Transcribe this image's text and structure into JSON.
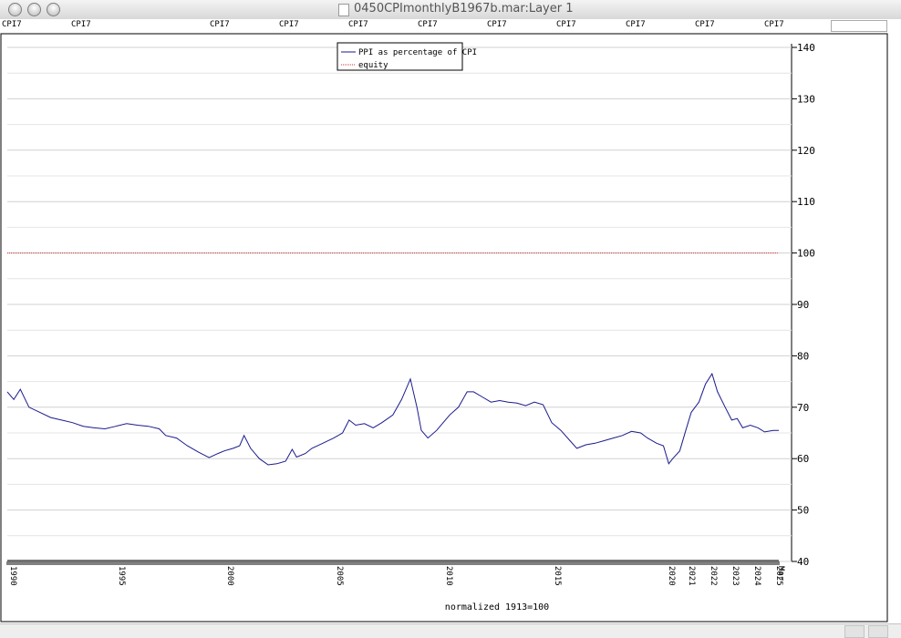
{
  "window": {
    "title": "0450CPImonthlyB1967b.mar:Layer 1"
  },
  "tag_label": "CPI7",
  "tag_count": 12,
  "chart_data": {
    "type": "line",
    "xlabel": "normalized 1913=100",
    "ylim": [
      40,
      140
    ],
    "yticks": [
      40,
      50,
      60,
      70,
      80,
      90,
      100,
      110,
      120,
      130,
      140
    ],
    "xticks": [
      "1990",
      "1995",
      "2000",
      "2005",
      "2010",
      "2015",
      "2020",
      "2021",
      "2022",
      "2023",
      "2024",
      "2025",
      "Mar"
    ],
    "grid": true,
    "legend_position": "top-center",
    "series": [
      {
        "name": "PPI as percentage of CPI",
        "color": "#1a1a8c",
        "points": [
          [
            1990.0,
            73.0
          ],
          [
            1990.3,
            71.5
          ],
          [
            1990.6,
            73.5
          ],
          [
            1991.0,
            70.0
          ],
          [
            1991.5,
            69.0
          ],
          [
            1992.0,
            68.0
          ],
          [
            1992.5,
            67.5
          ],
          [
            1993.0,
            67.0
          ],
          [
            1993.5,
            66.3
          ],
          [
            1994.0,
            66.0
          ],
          [
            1994.5,
            65.8
          ],
          [
            1995.0,
            66.3
          ],
          [
            1995.5,
            66.8
          ],
          [
            1996.0,
            66.5
          ],
          [
            1996.5,
            66.3
          ],
          [
            1997.0,
            65.8
          ],
          [
            1997.3,
            64.5
          ],
          [
            1997.8,
            64.0
          ],
          [
            1998.3,
            62.5
          ],
          [
            1998.8,
            61.3
          ],
          [
            1999.3,
            60.2
          ],
          [
            1999.7,
            61.0
          ],
          [
            2000.0,
            61.5
          ],
          [
            2000.4,
            62.0
          ],
          [
            2000.7,
            62.5
          ],
          [
            2000.9,
            64.5
          ],
          [
            2001.2,
            62.0
          ],
          [
            2001.6,
            60.0
          ],
          [
            2002.0,
            58.8
          ],
          [
            2002.4,
            59.0
          ],
          [
            2002.8,
            59.5
          ],
          [
            2003.1,
            61.8
          ],
          [
            2003.3,
            60.3
          ],
          [
            2003.7,
            61.0
          ],
          [
            2004.0,
            62.0
          ],
          [
            2004.5,
            63.0
          ],
          [
            2005.0,
            64.0
          ],
          [
            2005.4,
            65.0
          ],
          [
            2005.7,
            67.5
          ],
          [
            2006.0,
            66.5
          ],
          [
            2006.4,
            66.8
          ],
          [
            2006.8,
            66.0
          ],
          [
            2007.2,
            67.0
          ],
          [
            2007.7,
            68.5
          ],
          [
            2008.1,
            71.5
          ],
          [
            2008.5,
            75.5
          ],
          [
            2008.8,
            70.0
          ],
          [
            2009.0,
            65.5
          ],
          [
            2009.3,
            64.0
          ],
          [
            2009.7,
            65.5
          ],
          [
            2010.0,
            67.0
          ],
          [
            2010.3,
            68.5
          ],
          [
            2010.7,
            70.0
          ],
          [
            2011.1,
            73.0
          ],
          [
            2011.4,
            73.0
          ],
          [
            2011.8,
            72.0
          ],
          [
            2012.2,
            71.0
          ],
          [
            2012.6,
            71.3
          ],
          [
            2013.0,
            71.0
          ],
          [
            2013.4,
            70.8
          ],
          [
            2013.8,
            70.3
          ],
          [
            2014.2,
            71.0
          ],
          [
            2014.6,
            70.5
          ],
          [
            2015.0,
            67.0
          ],
          [
            2015.4,
            65.5
          ],
          [
            2015.8,
            63.5
          ],
          [
            2016.1,
            62.0
          ],
          [
            2016.5,
            62.7
          ],
          [
            2016.9,
            63.0
          ],
          [
            2017.3,
            63.5
          ],
          [
            2017.7,
            64.0
          ],
          [
            2018.1,
            64.5
          ],
          [
            2018.5,
            65.3
          ],
          [
            2018.9,
            65.0
          ],
          [
            2019.2,
            64.0
          ],
          [
            2019.6,
            63.0
          ],
          [
            2019.9,
            62.5
          ],
          [
            2020.15,
            59.0
          ],
          [
            2020.35,
            60.0
          ],
          [
            2020.7,
            61.5
          ],
          [
            2021.0,
            65.5
          ],
          [
            2021.25,
            69.0
          ],
          [
            2021.6,
            71.0
          ],
          [
            2021.9,
            74.5
          ],
          [
            2022.2,
            76.5
          ],
          [
            2022.45,
            73.0
          ],
          [
            2022.8,
            70.0
          ],
          [
            2023.1,
            67.5
          ],
          [
            2023.35,
            67.8
          ],
          [
            2023.6,
            66.0
          ],
          [
            2023.95,
            66.5
          ],
          [
            2024.3,
            66.0
          ],
          [
            2024.6,
            65.2
          ],
          [
            2025.0,
            65.5
          ],
          [
            2025.25,
            65.5
          ]
        ]
      },
      {
        "name": "equity",
        "color": "#cc3333",
        "dashed": true,
        "points": [
          [
            1990.0,
            100
          ],
          [
            2025.2,
            100
          ]
        ]
      }
    ]
  }
}
